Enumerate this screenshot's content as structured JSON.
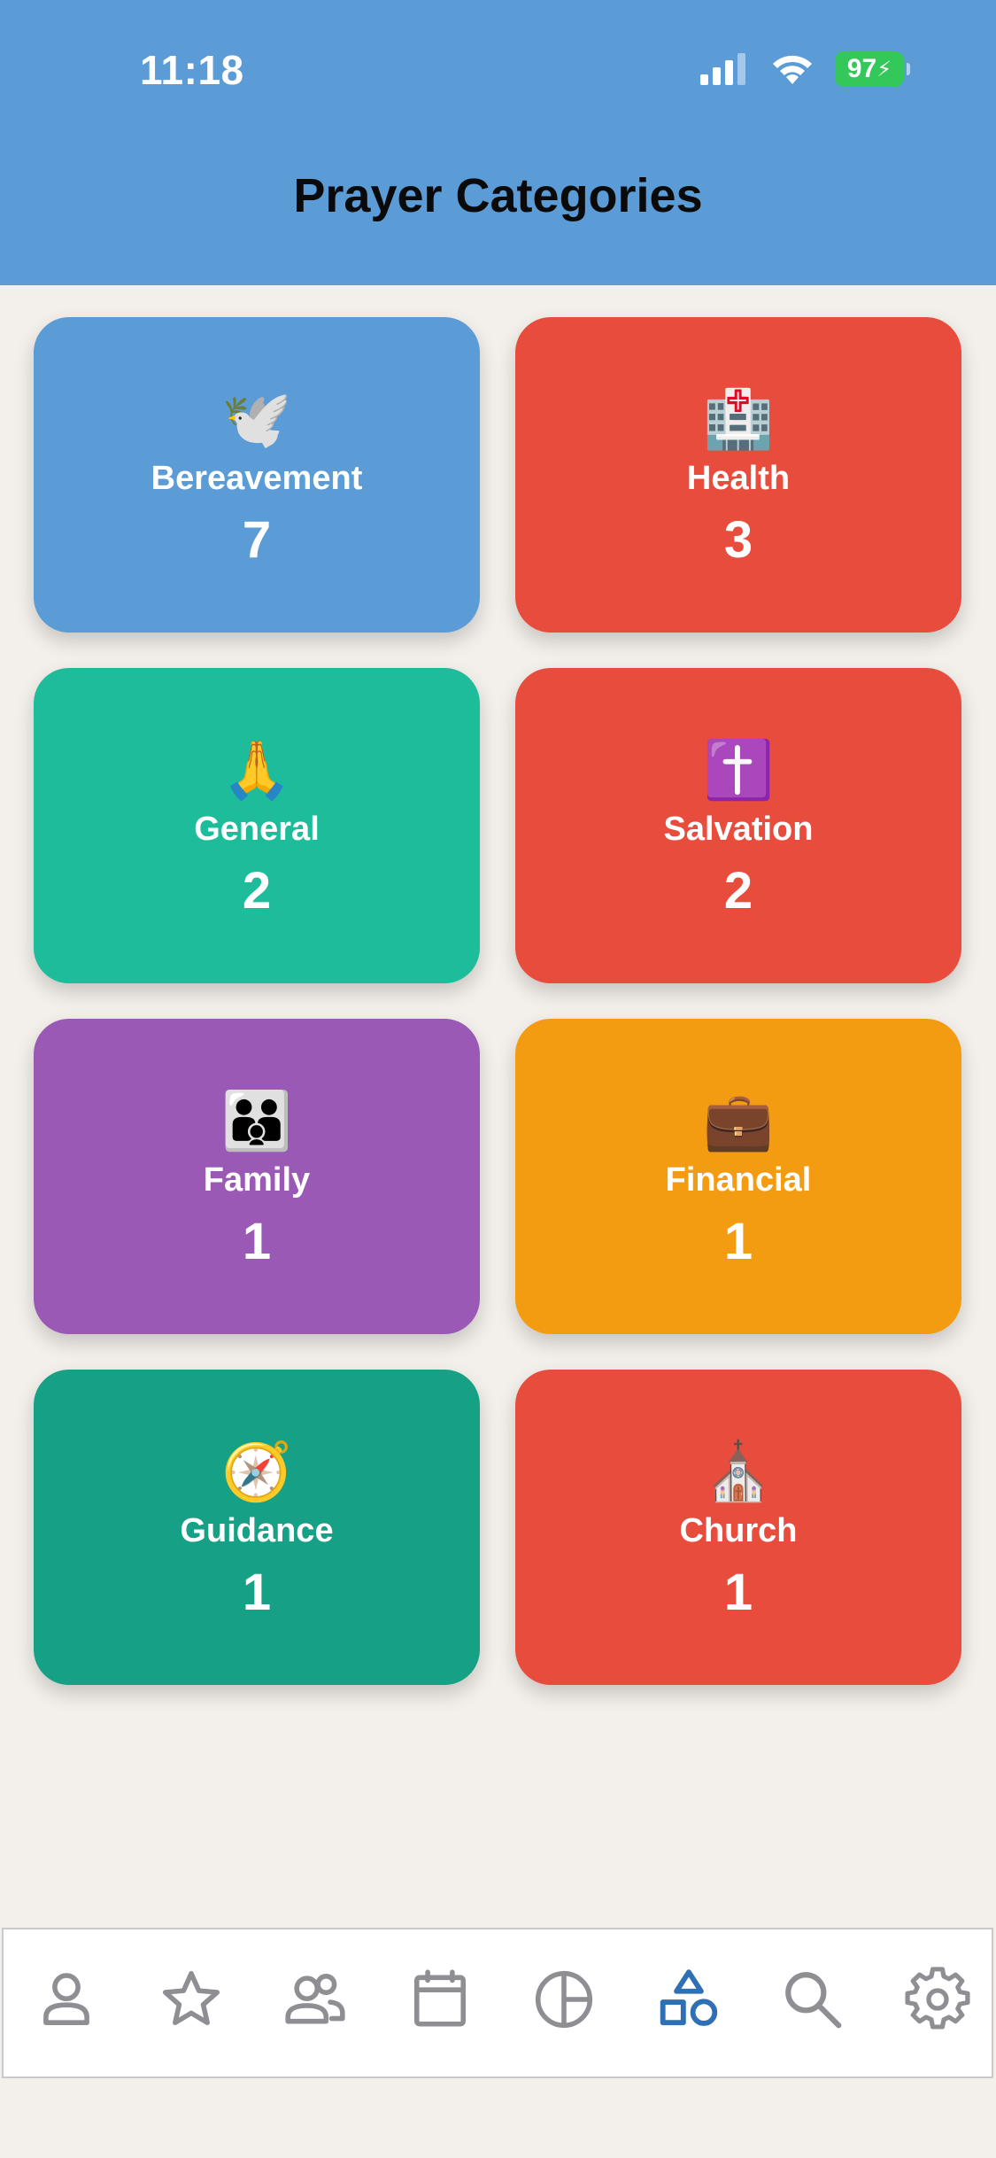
{
  "status": {
    "time": "11:18",
    "battery": "97"
  },
  "header": {
    "title": "Prayer Categories"
  },
  "categories": [
    {
      "name": "Bereavement",
      "count": "7",
      "icon": "🕊️",
      "icon_name": "dove-icon",
      "color": "#5b9bd6"
    },
    {
      "name": "Health",
      "count": "3",
      "icon": "🏥",
      "icon_name": "hospital-icon",
      "color": "#e84c3d"
    },
    {
      "name": "General",
      "count": "2",
      "icon": "🙏",
      "icon_name": "praying-hands-icon",
      "color": "#1dbc9a"
    },
    {
      "name": "Salvation",
      "count": "2",
      "icon": "✝️",
      "icon_name": "cross-icon",
      "color": "#e84c3d"
    },
    {
      "name": "Family",
      "count": "1",
      "icon": "👪",
      "icon_name": "family-icon",
      "color": "#9b59b6"
    },
    {
      "name": "Financial",
      "count": "1",
      "icon": "💼",
      "icon_name": "briefcase-icon",
      "color": "#f39c12"
    },
    {
      "name": "Guidance",
      "count": "1",
      "icon": "🧭",
      "icon_name": "compass-icon",
      "color": "#16a085"
    },
    {
      "name": "Church",
      "count": "1",
      "icon": "⛪",
      "icon_name": "church-icon",
      "color": "#e84c3d"
    }
  ],
  "tabbar": {
    "items": [
      {
        "icon_name": "person-icon",
        "active": false
      },
      {
        "icon_name": "star-icon",
        "active": false
      },
      {
        "icon_name": "group-icon",
        "active": false
      },
      {
        "icon_name": "calendar-icon",
        "active": false
      },
      {
        "icon_name": "pie-chart-icon",
        "active": false
      },
      {
        "icon_name": "shapes-icon",
        "active": true
      },
      {
        "icon_name": "search-icon",
        "active": false
      },
      {
        "icon_name": "gear-icon",
        "active": false
      }
    ],
    "inactive_color": "#8e8e93",
    "active_color": "#2f6fb3"
  }
}
